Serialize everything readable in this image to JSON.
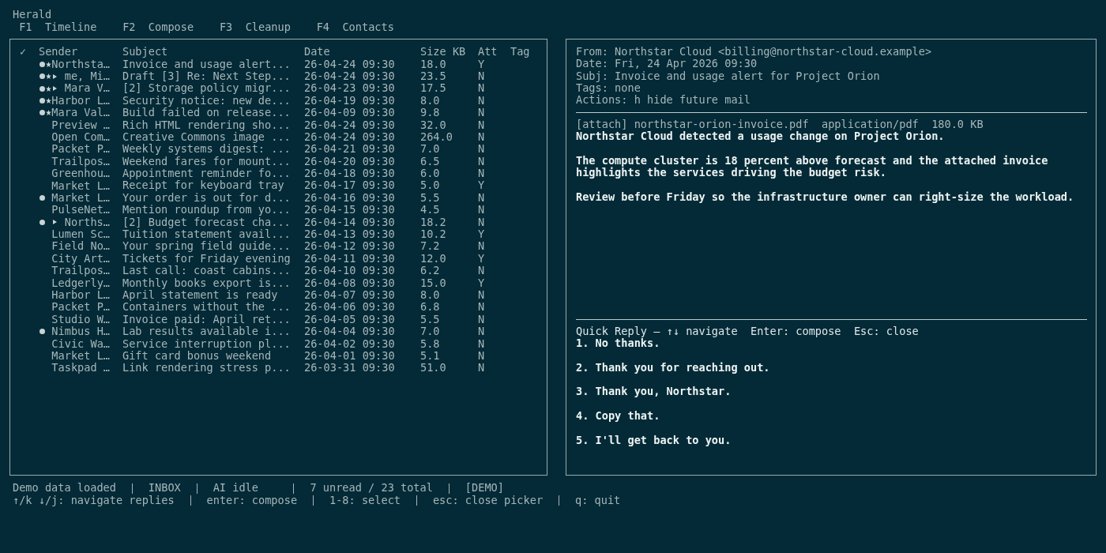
{
  "app": {
    "title": "Herald"
  },
  "tabs": [
    {
      "key": "F1",
      "label": "Timeline"
    },
    {
      "key": "F2",
      "label": "Compose"
    },
    {
      "key": "F3",
      "label": "Cleanup"
    },
    {
      "key": "F4",
      "label": "Contacts"
    }
  ],
  "message_list": {
    "columns": [
      "✓",
      "Sender",
      "Subject",
      "Date",
      "Size KB",
      "Att",
      "Tag"
    ],
    "rows": [
      {
        "unread": true,
        "starred": true,
        "thread": false,
        "sender": "Northsta…",
        "subject": "Invoice and usage alert...",
        "date": "26-04-24 09:30",
        "size": "18.0",
        "attachment": "Y"
      },
      {
        "unread": true,
        "starred": true,
        "thread": true,
        "sender": "me, Mi…",
        "subject": "Draft [3] Re: Next Step...",
        "date": "26-04-24 09:30",
        "size": "23.5",
        "attachment": "N"
      },
      {
        "unread": true,
        "starred": true,
        "thread": true,
        "sender": "Mara V…",
        "subject": "[2] Storage policy migr...",
        "date": "26-04-23 09:30",
        "size": "17.5",
        "attachment": "N"
      },
      {
        "unread": true,
        "starred": true,
        "thread": false,
        "sender": "Harbor L…",
        "subject": "Security notice: new de...",
        "date": "26-04-19 09:30",
        "size": "8.0",
        "attachment": "N"
      },
      {
        "unread": true,
        "starred": true,
        "thread": false,
        "sender": "Mara Val…",
        "subject": "Build failed on release...",
        "date": "26-04-09 09:30",
        "size": "9.8",
        "attachment": "N"
      },
      {
        "unread": false,
        "starred": false,
        "thread": false,
        "sender": "Preview …",
        "subject": "Rich HTML rendering sho...",
        "date": "26-04-24 09:30",
        "size": "32.0",
        "attachment": "N"
      },
      {
        "unread": false,
        "starred": false,
        "thread": false,
        "sender": "Open Com…",
        "subject": "Creative Commons image ...",
        "date": "26-04-24 09:30",
        "size": "264.0",
        "attachment": "N"
      },
      {
        "unread": false,
        "starred": false,
        "thread": false,
        "sender": "Packet P…",
        "subject": "Weekly systems digest: ...",
        "date": "26-04-21 09:30",
        "size": "7.0",
        "attachment": "N"
      },
      {
        "unread": false,
        "starred": false,
        "thread": false,
        "sender": "Trailpos…",
        "subject": "Weekend fares for mount...",
        "date": "26-04-20 09:30",
        "size": "6.5",
        "attachment": "N"
      },
      {
        "unread": false,
        "starred": false,
        "thread": false,
        "sender": "Greenhou…",
        "subject": "Appointment reminder fo...",
        "date": "26-04-18 09:30",
        "size": "6.0",
        "attachment": "N"
      },
      {
        "unread": false,
        "starred": false,
        "thread": false,
        "sender": "Market L…",
        "subject": "Receipt for keyboard tray",
        "date": "26-04-17 09:30",
        "size": "5.0",
        "attachment": "Y"
      },
      {
        "unread": true,
        "starred": false,
        "thread": false,
        "sender": "Market L…",
        "subject": "Your order is out for d...",
        "date": "26-04-16 09:30",
        "size": "5.5",
        "attachment": "N"
      },
      {
        "unread": false,
        "starred": false,
        "thread": false,
        "sender": "PulseNet…",
        "subject": "Mention roundup from yo...",
        "date": "26-04-15 09:30",
        "size": "4.5",
        "attachment": "N"
      },
      {
        "unread": true,
        "starred": false,
        "thread": true,
        "sender": "Norths…",
        "subject": "[2] Budget forecast cha...",
        "date": "26-04-14 09:30",
        "size": "18.2",
        "attachment": "N"
      },
      {
        "unread": false,
        "starred": false,
        "thread": false,
        "sender": "Lumen Sc…",
        "subject": "Tuition statement avail...",
        "date": "26-04-13 09:30",
        "size": "10.2",
        "attachment": "Y"
      },
      {
        "unread": false,
        "starred": false,
        "thread": false,
        "sender": "Field No…",
        "subject": "Your spring field guide...",
        "date": "26-04-12 09:30",
        "size": "7.2",
        "attachment": "N"
      },
      {
        "unread": false,
        "starred": false,
        "thread": false,
        "sender": "City Art…",
        "subject": "Tickets for Friday evening",
        "date": "26-04-11 09:30",
        "size": "12.0",
        "attachment": "Y"
      },
      {
        "unread": false,
        "starred": false,
        "thread": false,
        "sender": "Trailpos…",
        "subject": "Last call: coast cabins...",
        "date": "26-04-10 09:30",
        "size": "6.2",
        "attachment": "N"
      },
      {
        "unread": false,
        "starred": false,
        "thread": false,
        "sender": "Ledgerly…",
        "subject": "Monthly books export is...",
        "date": "26-04-08 09:30",
        "size": "15.0",
        "attachment": "Y"
      },
      {
        "unread": false,
        "starred": false,
        "thread": false,
        "sender": "Harbor L…",
        "subject": "April statement is ready",
        "date": "26-04-07 09:30",
        "size": "8.0",
        "attachment": "N"
      },
      {
        "unread": false,
        "starred": false,
        "thread": false,
        "sender": "Packet P…",
        "subject": "Containers without the ...",
        "date": "26-04-06 09:30",
        "size": "6.8",
        "attachment": "N"
      },
      {
        "unread": false,
        "starred": false,
        "thread": false,
        "sender": "Studio W…",
        "subject": "Invoice paid: April ret...",
        "date": "26-04-05 09:30",
        "size": "5.5",
        "attachment": "N"
      },
      {
        "unread": true,
        "starred": false,
        "thread": false,
        "sender": "Nimbus H…",
        "subject": "Lab results available i...",
        "date": "26-04-04 09:30",
        "size": "7.0",
        "attachment": "N"
      },
      {
        "unread": false,
        "starred": false,
        "thread": false,
        "sender": "Civic Wa…",
        "subject": "Service interruption pl...",
        "date": "26-04-02 09:30",
        "size": "5.8",
        "attachment": "N"
      },
      {
        "unread": false,
        "starred": false,
        "thread": false,
        "sender": "Market L…",
        "subject": "Gift card bonus weekend",
        "date": "26-04-01 09:30",
        "size": "5.1",
        "attachment": "N"
      },
      {
        "unread": false,
        "starred": false,
        "thread": false,
        "sender": "Taskpad …",
        "subject": "Link rendering stress p...",
        "date": "26-03-31 09:30",
        "size": "51.0",
        "attachment": "N"
      }
    ]
  },
  "preview": {
    "headers": [
      {
        "label": "From:",
        "value": "Northstar Cloud <billing@northstar-cloud.example>"
      },
      {
        "label": "Date:",
        "value": "Fri, 24 Apr 2026 09:30"
      },
      {
        "label": "Subj:",
        "value": "Invoice and usage alert for Project Orion"
      },
      {
        "label": "Tags:",
        "value": "none"
      },
      {
        "label": "Actions:",
        "value": "h hide future mail"
      }
    ],
    "attachment": "[attach] northstar-orion-invoice.pdf  application/pdf  180.0 KB",
    "body": [
      "Northstar Cloud detected a usage change on Project Orion.",
      "The compute cluster is 18 percent above forecast and the attached invoice highlights the services driving the budget risk.",
      "Review before Friday so the infrastructure owner can right-size the workload."
    ]
  },
  "quick_reply": {
    "header": "Quick Reply — ↑↓ navigate  Enter: compose  Esc: close",
    "options": [
      "1. No thanks.",
      "2. Thank you for reaching out.",
      "3. Thank you, Northstar.",
      "4. Copy that.",
      "5. I'll get back to you."
    ]
  },
  "status_bar": {
    "segments": [
      "Demo data loaded",
      "INBOX",
      "AI idle",
      "7 unread / 23 total",
      "[DEMO]"
    ]
  },
  "key_hints": [
    "↑/k ↓/j: navigate replies",
    "enter: compose",
    "1-8: select",
    "esc: close picker",
    "q: quit"
  ]
}
